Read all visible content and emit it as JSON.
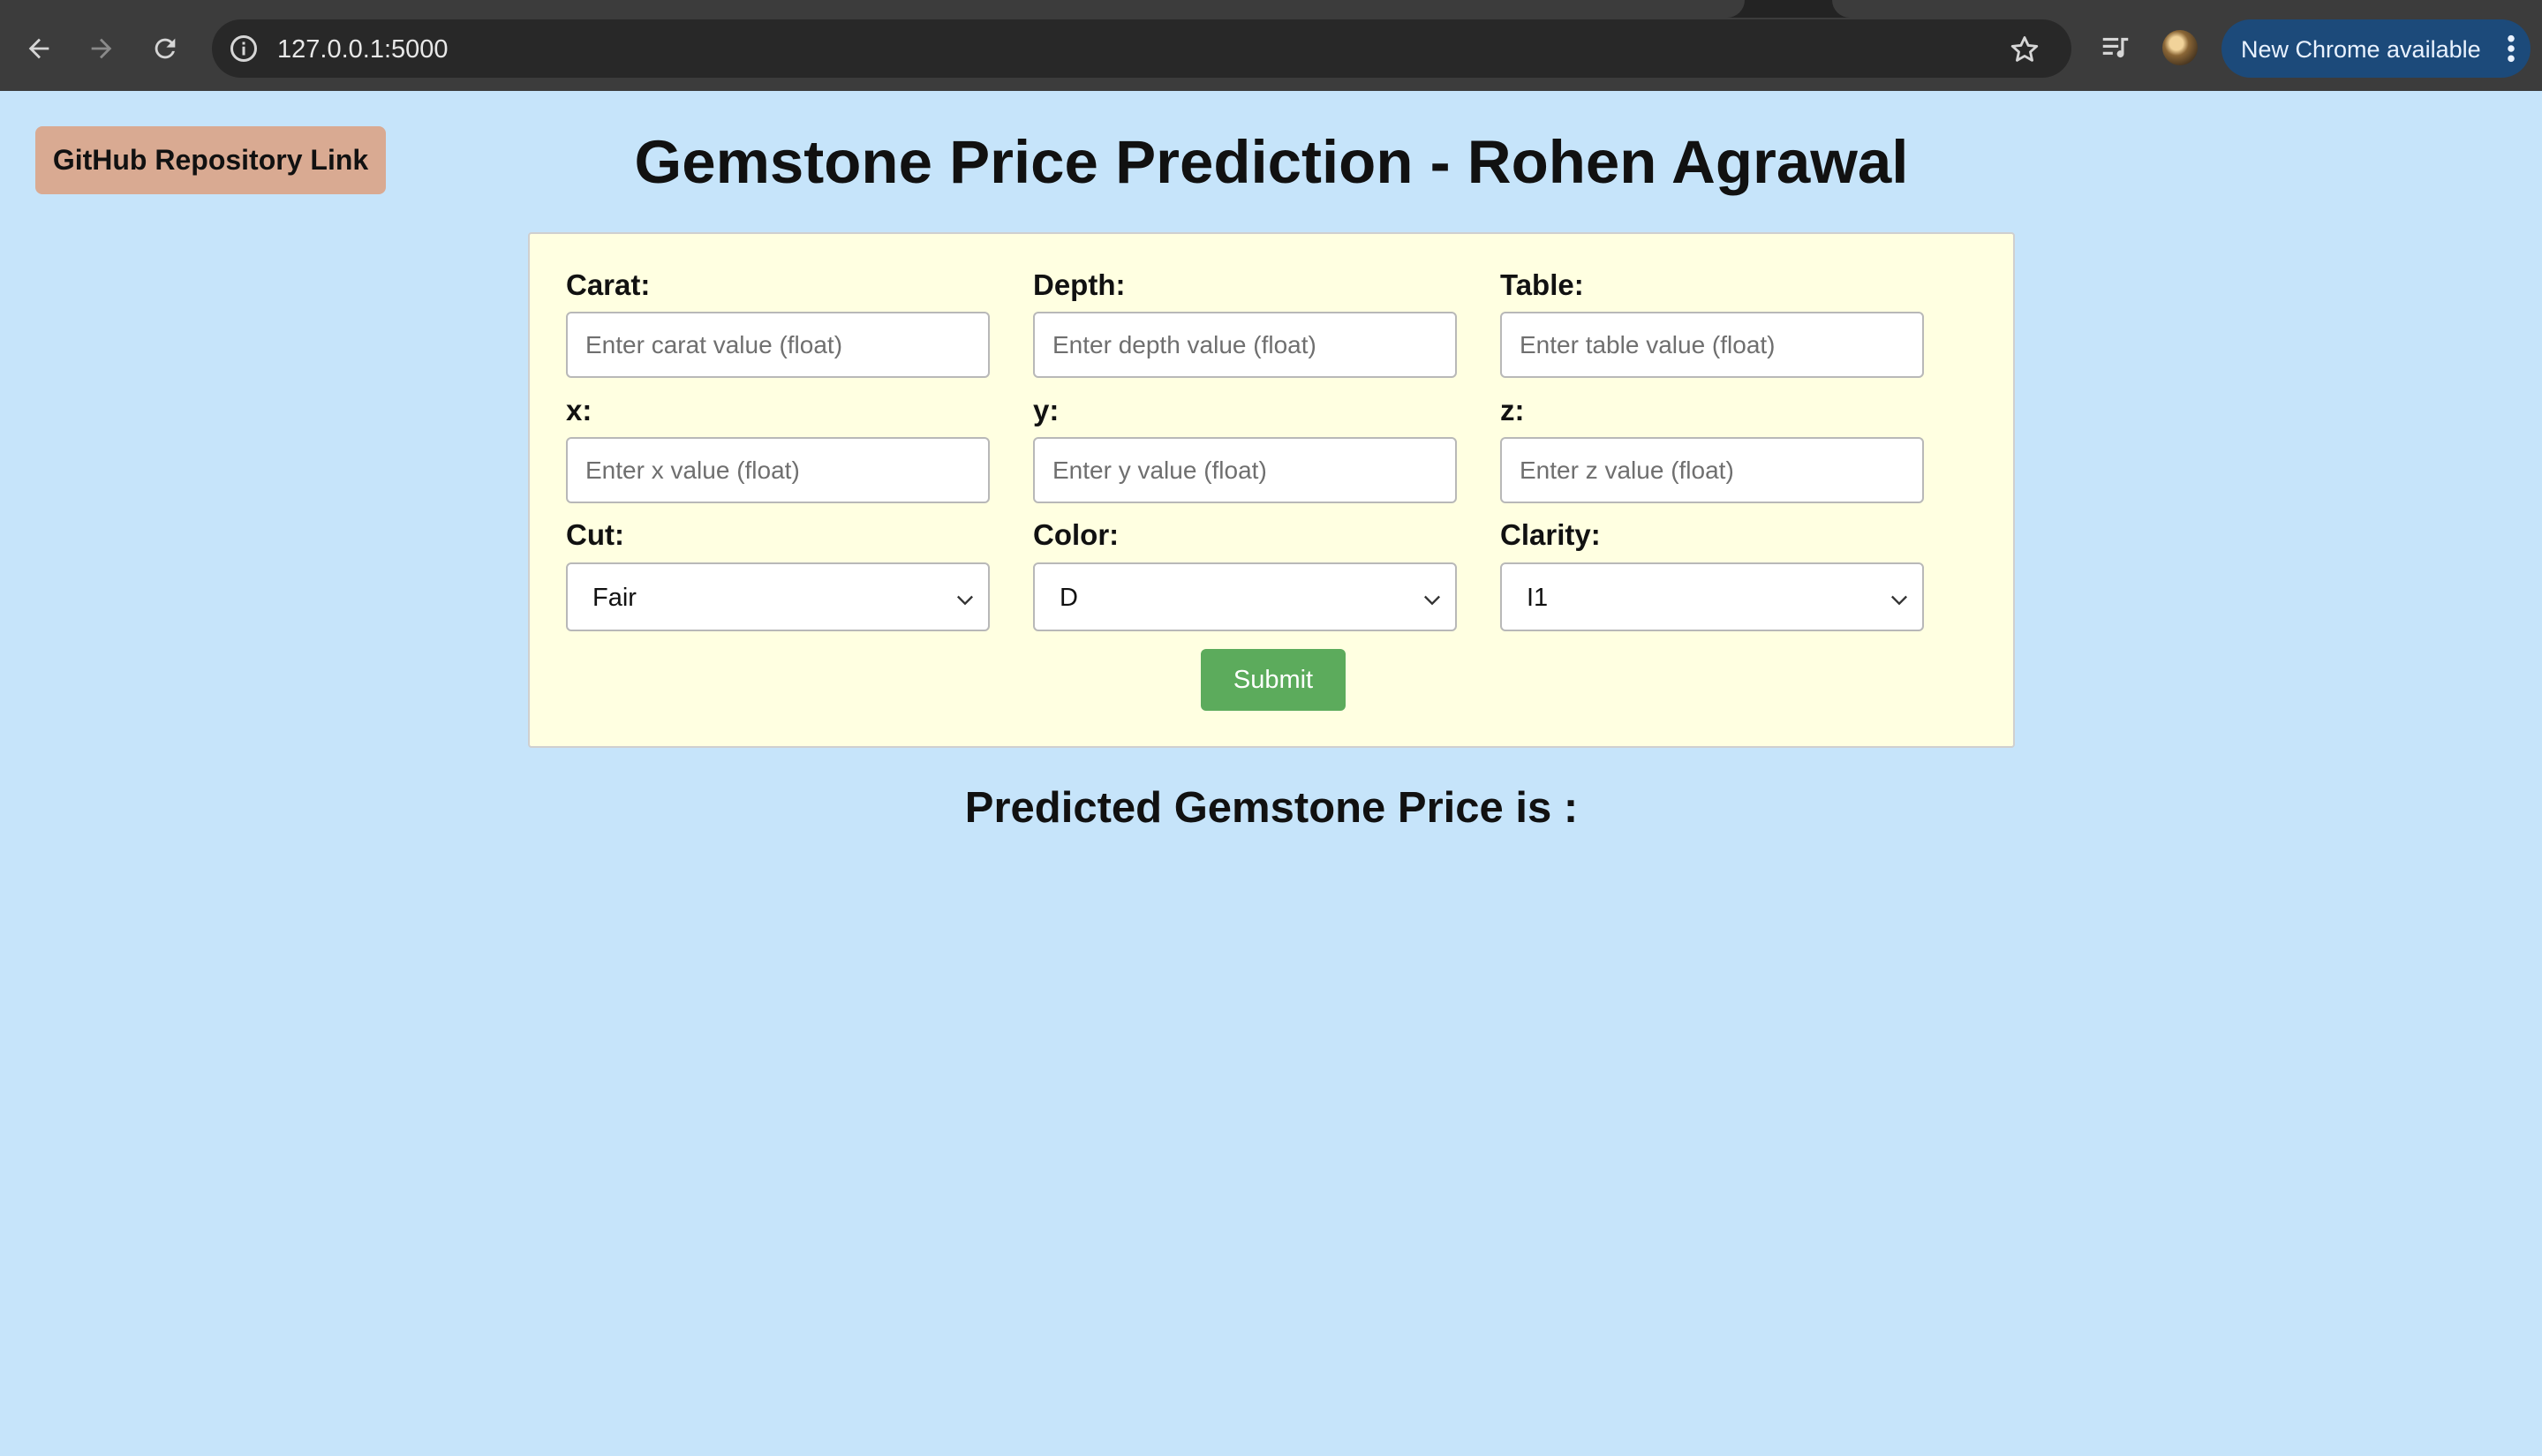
{
  "browser": {
    "url": "127.0.0.1:5000",
    "update_label": "New Chrome available",
    "icons": {
      "back": "back-arrow-icon",
      "forward": "forward-arrow-icon",
      "reload": "reload-icon",
      "site_info": "info-icon",
      "bookmark": "star-icon",
      "media": "media-controls-icon",
      "menu": "kebab-menu-icon"
    }
  },
  "header": {
    "github_link_label": "GitHub Repository Link",
    "title": "Gemstone Price Prediction - Rohen Agrawal"
  },
  "form": {
    "carat": {
      "label": "Carat:",
      "placeholder": "Enter carat value (float)"
    },
    "depth": {
      "label": "Depth:",
      "placeholder": "Enter depth value (float)"
    },
    "table": {
      "label": "Table:",
      "placeholder": "Enter table value (float)"
    },
    "x": {
      "label": "x:",
      "placeholder": "Enter x value (float)"
    },
    "y": {
      "label": "y:",
      "placeholder": "Enter y value (float)"
    },
    "z": {
      "label": "z:",
      "placeholder": "Enter z value (float)"
    },
    "cut": {
      "label": "Cut:",
      "selected": "Fair"
    },
    "color": {
      "label": "Color:",
      "selected": "D"
    },
    "clarity": {
      "label": "Clarity:",
      "selected": "I1"
    },
    "submit_label": "Submit"
  },
  "result": {
    "heading": "Predicted Gemstone Price is :"
  },
  "colors": {
    "page_background": "#c6e4fa",
    "form_background": "#ffffe1",
    "github_button": "#d9aa92",
    "submit_button": "#5cab5c",
    "chrome_update_pill": "#1c4a7a"
  }
}
